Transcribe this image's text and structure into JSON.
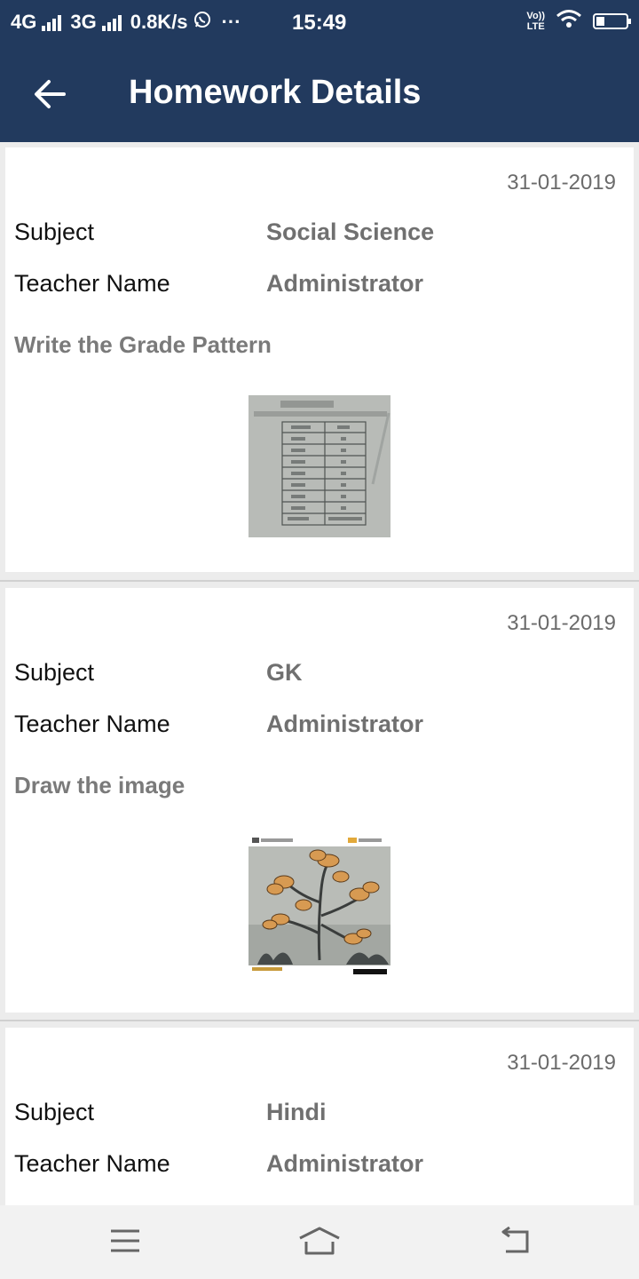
{
  "status_bar": {
    "network_1": "4G",
    "network_2": "3G",
    "speed": "0.8K/s",
    "whatsapp_icon": "whatsapp-icon",
    "more": "···",
    "time": "15:49",
    "volte_top": "Vo))",
    "volte_bottom": "LTE"
  },
  "header": {
    "title": "Homework Details",
    "back_icon": "arrow-left-icon",
    "background_color": "#223a5e"
  },
  "homework": [
    {
      "date": "31-01-2019",
      "subject_label": "Subject",
      "subject": "Social Science",
      "teacher_label": "Teacher Name",
      "teacher": "Administrator",
      "description": "Write the Grade Pattern",
      "attachment_image": "grade-table-photo"
    },
    {
      "date": "31-01-2019",
      "subject_label": "Subject",
      "subject": "GK",
      "teacher_label": "Teacher Name",
      "teacher": "Administrator",
      "description": "Draw the image",
      "attachment_image": "flower-drawing-photo"
    },
    {
      "date": "31-01-2019",
      "subject_label": "Subject",
      "subject": "Hindi",
      "teacher_label": "Teacher Name",
      "teacher": "Administrator"
    }
  ],
  "navbar": {
    "menu_icon": "menu-icon",
    "home_icon": "home-icon",
    "back_icon": "back-icon"
  }
}
